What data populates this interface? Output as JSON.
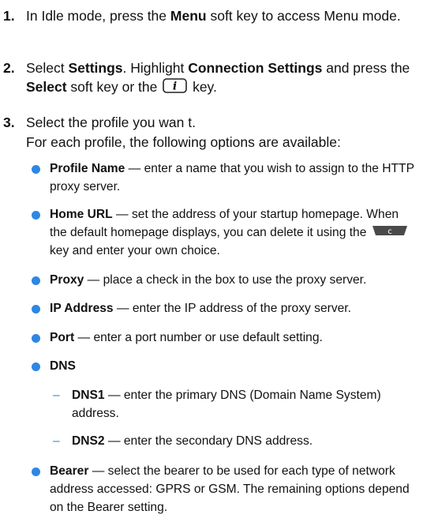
{
  "steps": [
    {
      "num": "1.",
      "parts": [
        "In Idle mode, press the ",
        "Menu",
        " soft key to access Menu mode."
      ]
    },
    {
      "num": "2.",
      "parts": [
        "Select ",
        "Settings",
        ". Highlight ",
        "Connection Settings",
        " and press the ",
        "Select",
        " soft key or the ",
        " key."
      ],
      "key_icon": "info-key-icon"
    },
    {
      "num": "3.",
      "line1": "Select the profile you wan t.",
      "line2": "For each profile, the following options are available:"
    }
  ],
  "options": [
    {
      "term": "Profile Name",
      "desc": " — enter a name that you wish to assign to the HTTP proxy server."
    },
    {
      "term": "Home URL",
      "desc": " — set the address of your startup homepage. When the default homepage displays, you can delete it using the ",
      "desc2": " key and enter your own choice.",
      "key_icon": "c-key-icon"
    },
    {
      "term": "Proxy",
      "desc": " — place a check in the box to use the proxy server."
    },
    {
      "term": "IP Address",
      "desc": " — enter the IP address of the proxy server."
    },
    {
      "term": "Port",
      "desc": " — enter a port number or use default setting."
    },
    {
      "term": "DNS",
      "desc": ""
    },
    {
      "term": "Bearer",
      "desc": " — select the bearer to be used for each type of network address accessed: GPRS or GSM. The remaining options depend on the Bearer setting."
    }
  ],
  "dns_sub": [
    {
      "term": "DNS1",
      "desc": " — enter the primary DNS (Domain Name System) address."
    },
    {
      "term": "DNS2",
      "desc": " — enter the secondary DNS address."
    }
  ],
  "bullet_color": "#2f86e4",
  "dash_glyph": "–"
}
